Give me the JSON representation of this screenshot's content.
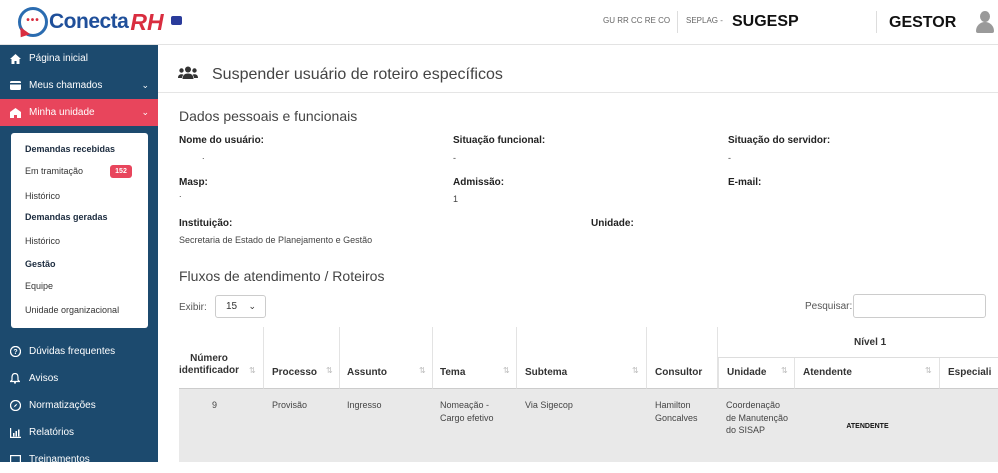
{
  "header": {
    "logo_text": "Conecta",
    "logo_rh": "RH",
    "links": "GU RR CC RE CO",
    "seplag": "SEPLAG -",
    "org": "SUGESP",
    "role": "GESTOR"
  },
  "sidebar": {
    "items": [
      {
        "label": "Página inicial",
        "icon": "home-icon"
      },
      {
        "label": "Meus chamados",
        "icon": "card-icon"
      },
      {
        "label": "Minha unidade",
        "icon": "building-icon"
      },
      {
        "label": "Dúvidas frequentes",
        "icon": "question-icon"
      },
      {
        "label": "Avisos",
        "icon": "bell-icon"
      },
      {
        "label": "Normatizações",
        "icon": "compass-icon"
      },
      {
        "label": "Relatórios",
        "icon": "chart-icon"
      },
      {
        "label": "Treinamentos",
        "icon": "training-icon"
      }
    ],
    "submenu": {
      "demandas_recebidas": "Demandas recebidas",
      "em_tramitacao": "Em tramitação",
      "em_tramitacao_count": "152",
      "historico1": "Histórico",
      "demandas_geradas": "Demandas geradas",
      "historico2": "Histórico",
      "gestao": "Gestão",
      "equipe": "Equipe",
      "unidade_org": "Unidade organizacional"
    }
  },
  "main": {
    "title": "Suspender usuário de roteiro específicos",
    "dados_title": "Dados pessoais e funcionais",
    "fields": {
      "nome_label": "Nome do usuário:",
      "nome_value": ".",
      "situacao_funcional_label": "Situação funcional:",
      "situacao_funcional_value": "-",
      "situacao_servidor_label": "Situação do servidor:",
      "situacao_servidor_value": "-",
      "masp_label": "Masp:",
      "masp_value": ".",
      "admissao_label": "Admissão:",
      "admissao_value": "1",
      "email_label": "E-mail:",
      "instituicao_label": "Instituição:",
      "instituicao_value": "Secretaria de Estado de Planejamento e Gestão",
      "unidade_label": "Unidade:"
    },
    "fluxos_title": "Fluxos de atendimento / Roteiros",
    "exibir_label": "Exibir:",
    "exibir_value": "15",
    "pesquisar_label": "Pesquisar:",
    "table": {
      "group_header": "Nível 1",
      "columns": [
        "Número identificador",
        "Processo",
        "Assunto",
        "Tema",
        "Subtema",
        "Consultor",
        "Unidade",
        "Atendente",
        "Especiali"
      ],
      "rows": [
        {
          "numero": "9",
          "processo": "Provisão",
          "assunto": "Ingresso",
          "tema": "Nomeação - Cargo efetivo",
          "subtema": "Via Sigecop",
          "consultor": "Hamilton Goncalves",
          "unidade": "Coordenação de Manutenção do SISAP",
          "atendente": "ATENDENTE"
        }
      ]
    }
  }
}
